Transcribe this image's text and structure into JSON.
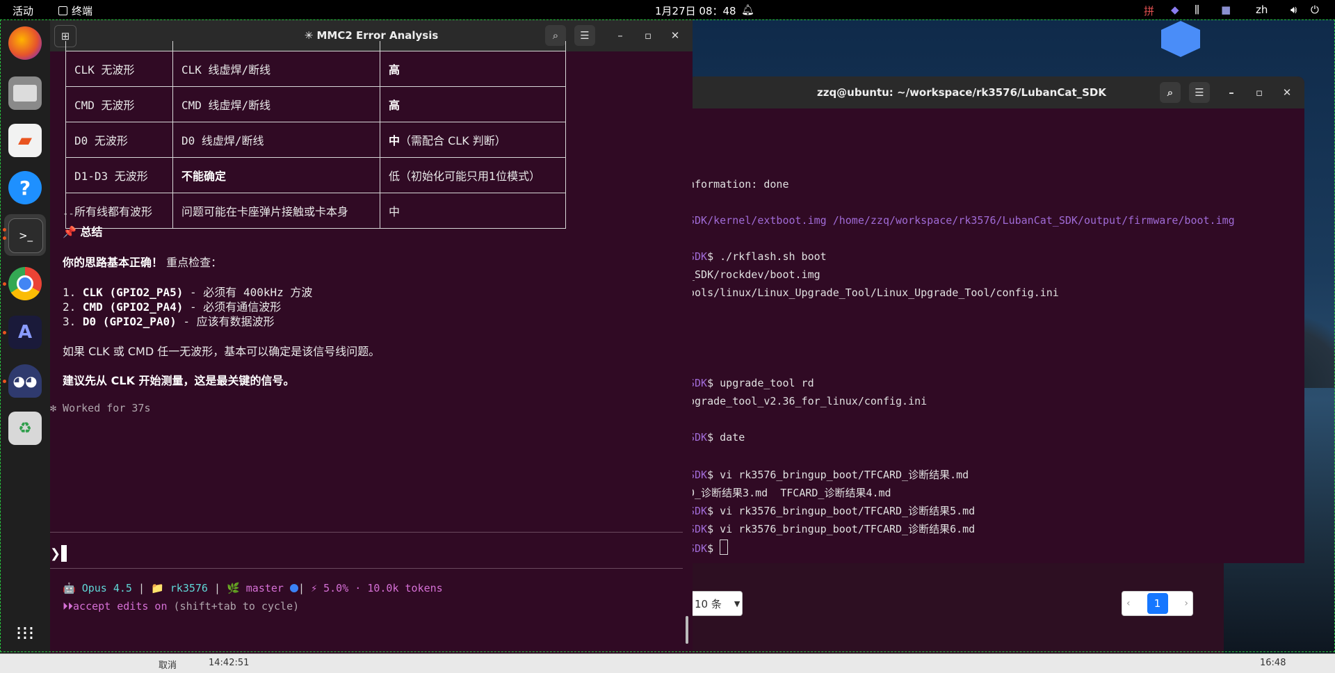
{
  "topbar": {
    "activities": "活动",
    "app_name": "终端",
    "clock": "1月27日 08：48",
    "ime": "拼",
    "lang": "zh"
  },
  "dock": {
    "apps": [
      "firefox-icon",
      "files-icon",
      "app-center-icon",
      "help-icon",
      "terminal-icon",
      "chrome-icon",
      "vpn-icon",
      "cat-icon",
      "trash-icon",
      "show-apps-icon"
    ]
  },
  "term2": {
    "title": "zzq@ubuntu: ~/workspace/rk3576/LubanCat_SDK",
    "lines": [
      {
        "prefix": "",
        "text": "nformation: done"
      },
      {
        "prefix": "SDK/kernel/extboot.img /home/zzq/workspace/rk3576/LubanCat_SDK/output/firmware/boot.img",
        "text": ""
      },
      {
        "prefix": "SDK",
        "text": "$ ./rkflash.sh boot"
      },
      {
        "prefix": "",
        "text": "_SDK/rockdev/boot.img"
      },
      {
        "prefix": "",
        "text": "ools/linux/Linux_Upgrade_Tool/Linux_Upgrade_Tool/config.ini"
      },
      {
        "prefix": "SDK",
        "text": "$ upgrade_tool rd"
      },
      {
        "prefix": "",
        "text": "pgrade_tool_v2.36_for_linux/config.ini"
      },
      {
        "prefix": "SDK",
        "text": "$ date"
      },
      {
        "prefix": "SDK",
        "text": "$ vi rk3576_bringup_boot/TFCARD_诊断结果.md"
      },
      {
        "prefix": "",
        "text": "D_诊断结果3.md  TFCARD_诊断结果4.md"
      },
      {
        "prefix": "SDK",
        "text": "$ vi rk3576_bringup_boot/TFCARD_诊断结果5.md"
      },
      {
        "prefix": "SDK",
        "text": "$ vi rk3576_bringup_boot/TFCARD_诊断结果6.md"
      },
      {
        "prefix": "SDK",
        "text": "$ "
      }
    ]
  },
  "web": {
    "page_size": "10 条",
    "current_page": "1"
  },
  "term1": {
    "title": "✳ MMC2 Error Analysis",
    "table": [
      [
        "CLK 无波形",
        "CLK 线虚焊/断线",
        "高"
      ],
      [
        "CMD 无波形",
        "CMD 线虚焊/断线",
        "高"
      ],
      [
        "D0 无波形",
        "D0 线虚焊/断线",
        "中（需配合 CLK 判断）"
      ],
      [
        "D1-D3 无波形",
        "不能确定",
        "低（初始化可能只用1位模式）"
      ],
      [
        "所有线都有波形",
        "问题可能在卡座弹片接触或卡本身",
        "中"
      ]
    ],
    "separator": "---",
    "summary_heading": "📌 总结",
    "intro_bold": "你的思路基本正确！",
    "intro_rest": " 重点检查：",
    "checks": [
      {
        "num": "1.",
        "bold": "CLK (GPIO2_PA5)",
        "rest": " - 必须有 400kHz 方波"
      },
      {
        "num": "2.",
        "bold": "CMD (GPIO2_PA4)",
        "rest": " - 必须有通信波形"
      },
      {
        "num": "3.",
        "bold": "D0 (GPIO2_PA0)",
        "rest": " - 应该有数据波形"
      }
    ],
    "conclusion": "如果 CLK 或 CMD 任一无波形，基本可以确定是该信号线问题。",
    "advice": "建议先从 CLK 开始测量，这是最关键的信号。",
    "worked": "✻ Worked for 37s",
    "prompt": "❯",
    "status": {
      "model": "🤖 Opus 4.5",
      "folder": "📁 rk3576",
      "branch": "🌿 master",
      "usage": "⚡ 5.0% · 10.0k tokens",
      "mode_icon": "⏵⏵",
      "mode": "accept edits on",
      "mode_hint": " (shift+tab to cycle)"
    }
  },
  "taskbar": {
    "items": [
      "取消",
      "14:42:51",
      "16:48"
    ]
  }
}
